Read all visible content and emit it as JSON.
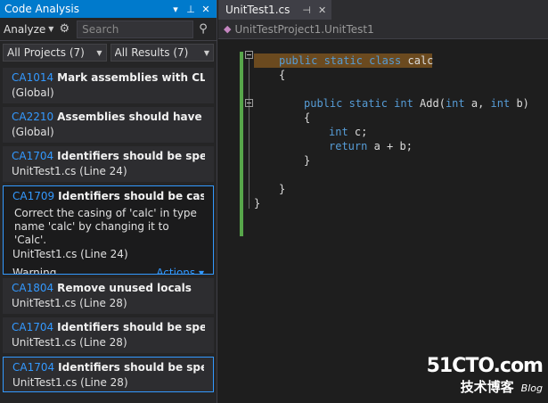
{
  "panel": {
    "title": "Code Analysis",
    "analyze_label": "Analyze",
    "search_placeholder": "Search",
    "project_filter": "All Projects (7)",
    "result_filter": "All Results (7)"
  },
  "items": [
    {
      "code": "CA1014",
      "message": "Mark assemblies with CLSCo...",
      "location": "(Global)"
    },
    {
      "code": "CA2210",
      "message": "Assemblies should have valid...",
      "location": "(Global)"
    },
    {
      "code": "CA1704",
      "message": "Identifiers should be spelled...",
      "location": "UnitTest1.cs (Line 24)"
    },
    {
      "code": "CA1709",
      "message": "Identifiers should be cased corr",
      "description": "Correct the casing of 'calc' in type name 'calc' by changing it to 'Calc'.",
      "location": "UnitTest1.cs (Line 24)",
      "severity": "Warning",
      "actions_label": "Actions"
    },
    {
      "code": "CA1804",
      "message": "Remove unused locals",
      "location": "UnitTest1.cs (Line 28)"
    },
    {
      "code": "CA1704",
      "message": "Identifiers should be spelled...",
      "location": "UnitTest1.cs (Line 28)"
    },
    {
      "code": "CA1704",
      "message": "Identifiers should be spelled...",
      "location": "UnitTest1.cs (Line 28)"
    }
  ],
  "editor": {
    "tab_label": "UnitTest1.cs",
    "nav_path": "UnitTestProject1.UnitTest1",
    "lines": {
      "l1_kw": "public static class",
      "l1_name": " calc",
      "l2": "{",
      "l3_kw1": "public static int",
      "l3_rest1": " Add(",
      "l3_kw2": "int",
      "l3_rest2": " a, ",
      "l3_kw3": "int",
      "l3_rest3": " b)",
      "l4": "{",
      "l5_kw": "int",
      "l5_rest": " c;",
      "l6_kw": "return",
      "l6_rest": " a + b;",
      "l7": "}",
      "l8": "}",
      "l9": "}"
    }
  },
  "watermark": {
    "site": "51CTO.com",
    "cn": "技术博客",
    "blog": "Blog"
  },
  "colors": {
    "accent": "#007acc",
    "link": "#3399ff",
    "keyword": "#569cd6"
  }
}
